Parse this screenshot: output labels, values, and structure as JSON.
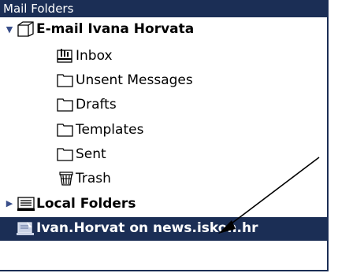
{
  "panel": {
    "title": "Mail Folders"
  },
  "account": {
    "name": "E-mail Ivana Horvata",
    "folders": [
      {
        "label": "Inbox",
        "icon": "inbox-icon"
      },
      {
        "label": "Unsent Messages",
        "icon": "folder-icon"
      },
      {
        "label": "Drafts",
        "icon": "folder-icon"
      },
      {
        "label": "Templates",
        "icon": "folder-icon"
      },
      {
        "label": "Sent",
        "icon": "folder-icon"
      },
      {
        "label": "Trash",
        "icon": "trash-icon"
      }
    ]
  },
  "local": {
    "name": "Local Folders"
  },
  "news": {
    "name": "Ivan.Horvat on news.iskon.hr"
  },
  "colors": {
    "header_bg": "#1b2e55",
    "selection_bg": "#1b2e55",
    "text": "#000000",
    "selected_text": "#ffffff"
  }
}
